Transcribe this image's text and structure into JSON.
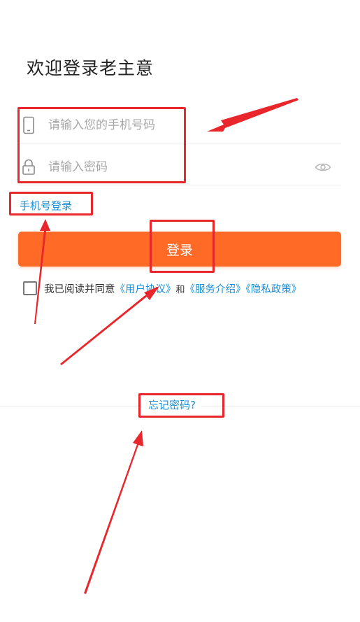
{
  "header": {
    "title": "欢迎登录老主意"
  },
  "form": {
    "phone_placeholder": "请输入您的手机号码",
    "password_placeholder": "请输入密码",
    "phone_icon": "phone-icon",
    "lock_icon": "lock-icon",
    "eye_icon": "eye-icon"
  },
  "links": {
    "phone_login": "手机号登录",
    "forgot_password": "忘记密码?"
  },
  "login_button": {
    "label": "登录",
    "color": "#ff6a26"
  },
  "agreement": {
    "prefix": "我已阅读并同意",
    "user_agreement": "《用户协议》",
    "and": "和",
    "service_intro": "《服务介绍》",
    "privacy_policy": "《隐私政策》",
    "checked": false
  },
  "theme": {
    "accent": "#ff6a26",
    "link": "#1a8fd6",
    "annotation": "#e8262b"
  }
}
